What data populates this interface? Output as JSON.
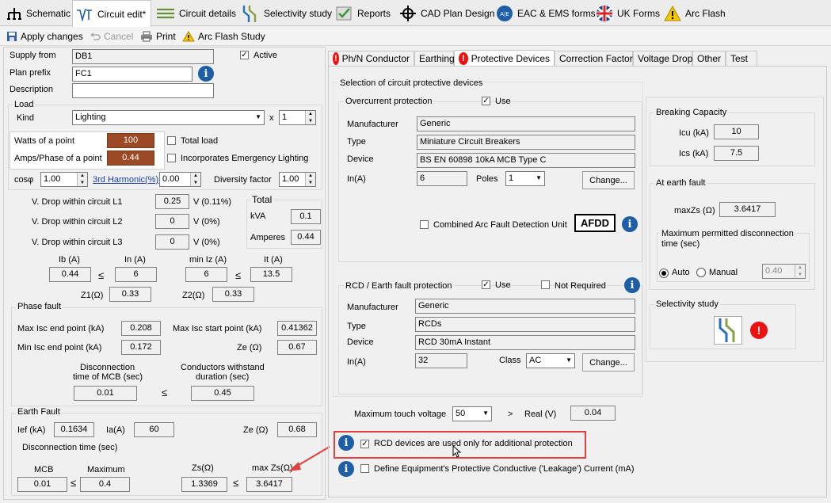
{
  "tabs": [
    {
      "label": "Schematic",
      "icon": "schematic-icon"
    },
    {
      "label": "Circuit edit*",
      "icon": "circuit-edit-icon"
    },
    {
      "label": "Circuit details",
      "icon": "list-icon"
    },
    {
      "label": "Selectivity study",
      "icon": "selectivity-icon"
    },
    {
      "label": "Reports",
      "icon": "report-check-icon"
    },
    {
      "label": "CAD Plan Design",
      "icon": "cad-crosshair-icon"
    },
    {
      "label": "EAC & EMS forms",
      "icon": "eac-ems-icon"
    },
    {
      "label": "UK Forms",
      "icon": "uk-flag-icon"
    },
    {
      "label": "Arc Flash",
      "icon": "warning-triangle-icon"
    }
  ],
  "toolbar": {
    "apply": "Apply changes",
    "cancel": "Cancel",
    "print": "Print",
    "arc": "Arc Flash Study"
  },
  "left": {
    "supply_from_label": "Supply from",
    "supply_from": "DB1",
    "active_label": "Active",
    "plan_prefix_label": "Plan prefix",
    "plan_prefix": "FC1",
    "description_label": "Description",
    "description": "",
    "load_title": "Load",
    "kind_label": "Kind",
    "kind": "Lighting",
    "x_label": "x",
    "multiplier": "1",
    "watts_label": "Watts of a point",
    "watts": "100",
    "total_load_label": "Total load",
    "amps_label": "Amps/Phase of a point",
    "amps": "0.44",
    "emergency_label": "Incorporates Emergency Lighting",
    "cos_label": "cosφ",
    "cos": "1.00",
    "harmonic_label": "3rd Harmonic(%)",
    "harmonic": "0.00",
    "diversity_label": "Diversity factor",
    "diversity": "1.00",
    "vdrop": [
      {
        "label": "V. Drop within circuit L1",
        "value": "0.25",
        "pct": "V (0.11%)"
      },
      {
        "label": "V. Drop within circuit L2",
        "value": "0",
        "pct": "V (0%)"
      },
      {
        "label": "V. Drop within circuit L3",
        "value": "0",
        "pct": "V (0%)"
      }
    ],
    "total_title": "Total",
    "kva_label": "kVA",
    "kva": "0.1",
    "amperes_label": "Amperes",
    "amperes": "0.44",
    "ib_label": "Ib (A)",
    "ib": "0.44",
    "in_label": "In (A)",
    "in": "6",
    "miniz_label": "min Iz (A)",
    "miniz": "6",
    "it_label": "It (A)",
    "it": "13.5",
    "leq": "≤",
    "z1_label": "Z1(Ω)",
    "z1": "0.33",
    "z2_label": "Z2(Ω)",
    "z2": "0.33",
    "phase_fault_title": "Phase fault",
    "max_isc_end_label": "Max Isc end point (kA)",
    "max_isc_end": "0.208",
    "max_isc_start_label": "Max Isc start point (kA)",
    "max_isc_start": "0.41362",
    "min_isc_end_label": "Min Isc end point (kA)",
    "min_isc_end": "0.172",
    "ze_label": "Ze (Ω)",
    "ze": "0.67",
    "disc_label1": "Disconnection",
    "disc_label2": "time of MCB (sec)",
    "disc": "0.01",
    "withstand_label1": "Conductors withstand",
    "withstand_label2": "duration (sec)",
    "withstand": "0.45",
    "earth_fault_title": "Earth Fault",
    "ief_label": "Ief (kA)",
    "ief": "0.1634",
    "ia_label": "Ia(A)",
    "ia": "60",
    "ef_ze_label": "Ze (Ω)",
    "ef_ze": "0.68",
    "disc_time_label": "Disconnection time (sec)",
    "mcb_label": "MCB",
    "mcb": "0.01",
    "maximum_label": "Maximum",
    "maximum": "0.4",
    "zs_label": "Zs(Ω)",
    "zs": "1.3369",
    "maxzs_label": "max Zs(Ω)",
    "maxzs": "3.6417"
  },
  "subtabs": [
    "Ph/N Conductor",
    "Earthing",
    "Protective Devices",
    "Correction Factors",
    "Voltage Drop",
    "Other",
    "Test"
  ],
  "right": {
    "selection_title": "Selection of circuit protective devices",
    "oc_title": "Overcurrent protection",
    "use_label": "Use",
    "manufacturer_label": "Manufacturer",
    "oc_manufacturer": "Generic",
    "type_label": "Type",
    "oc_type": "Miniature Circuit Breakers",
    "device_label": "Device",
    "oc_device": "BS EN 60898 10kA MCB Type C",
    "in_label": "In(A)",
    "oc_in": "6",
    "poles_label": "Poles",
    "poles": "1",
    "change_label": "Change...",
    "afdd_check_label": "Combined Arc Fault Detection Unit",
    "afdd_badge": "AFDD",
    "rcd_title": "RCD / Earth fault protection",
    "not_required_label": "Not Required",
    "rcd_manufacturer": "Generic",
    "rcd_type": "RCDs",
    "rcd_device": "RCD 30mA Instant",
    "rcd_in": "32",
    "class_label": "Class",
    "rcd_class": "AC",
    "breaking_title": "Breaking Capacity",
    "icu_label": "Icu (kA)",
    "icu": "10",
    "ics_label": "Ics (kA)",
    "ics": "7.5",
    "earth_fault_title": "At earth fault",
    "maxzs_label": "maxZs (Ω)",
    "maxzs": "3.6417",
    "mpdt_label1": "Maximum permitted disconnection",
    "mpdt_label2": "time (sec)",
    "auto_label": "Auto",
    "manual_label": "Manual",
    "manual_value": "0.40",
    "selectivity_title": "Selectivity study",
    "touch_label": "Maximum touch voltage",
    "touch": "50",
    "gt": ">",
    "real_label": "Real (V)",
    "real": "0.04",
    "rcd_additional_label": "RCD devices are used only for additional protection",
    "leakage_label": "Define Equipment's Protective Conductive ('Leakage') Current (mA)"
  },
  "colors": {
    "accent": "#1e5ea8",
    "highlight": "#e04040",
    "brown": "#9b4a25"
  }
}
